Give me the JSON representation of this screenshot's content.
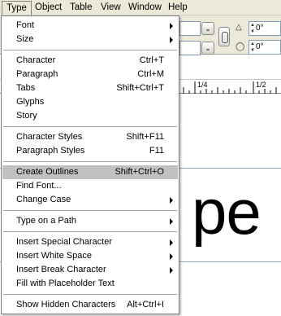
{
  "menubar": {
    "items": [
      "Type",
      "Object",
      "Table",
      "View",
      "Window",
      "Help"
    ]
  },
  "controls": {
    "angle_1": "0°",
    "angle_2": "0°"
  },
  "ruler": {
    "labels": [
      "1/4",
      "1/2"
    ]
  },
  "document": {
    "sample_text": "pe"
  },
  "type_menu": {
    "items": [
      {
        "label": "Font",
        "shortcut": "",
        "submenu": true
      },
      {
        "label": "Size",
        "shortcut": "",
        "submenu": true
      },
      {
        "label": "Character",
        "shortcut": "Ctrl+T",
        "submenu": false
      },
      {
        "label": "Paragraph",
        "shortcut": "Ctrl+M",
        "submenu": false
      },
      {
        "label": "Tabs",
        "shortcut": "Shift+Ctrl+T",
        "submenu": false
      },
      {
        "label": "Glyphs",
        "shortcut": "",
        "submenu": false
      },
      {
        "label": "Story",
        "shortcut": "",
        "submenu": false
      },
      {
        "label": "Character Styles",
        "shortcut": "Shift+F11",
        "submenu": false
      },
      {
        "label": "Paragraph Styles",
        "shortcut": "F11",
        "submenu": false
      },
      {
        "label": "Create Outlines",
        "shortcut": "Shift+Ctrl+O",
        "submenu": false,
        "highlighted": true
      },
      {
        "label": "Find Font...",
        "shortcut": "",
        "submenu": false
      },
      {
        "label": "Change Case",
        "shortcut": "",
        "submenu": true
      },
      {
        "label": "Type on a Path",
        "shortcut": "",
        "submenu": true
      },
      {
        "label": "Insert Special Character",
        "shortcut": "",
        "submenu": true
      },
      {
        "label": "Insert White Space",
        "shortcut": "",
        "submenu": true
      },
      {
        "label": "Insert Break Character",
        "shortcut": "",
        "submenu": true
      },
      {
        "label": "Fill with Placeholder Text",
        "shortcut": "",
        "submenu": false
      },
      {
        "label": "Show Hidden Characters",
        "shortcut": "Alt+Ctrl+I",
        "submenu": false
      }
    ]
  }
}
